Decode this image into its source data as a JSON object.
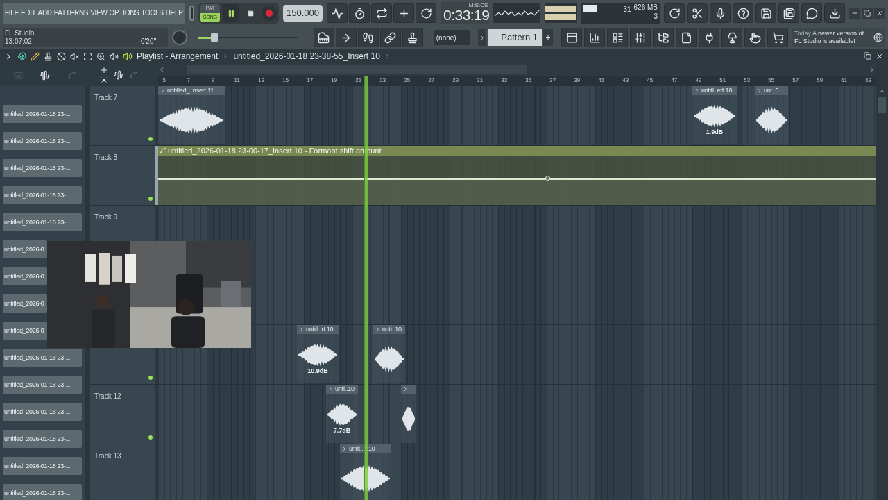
{
  "menu": [
    "FILE",
    "EDIT",
    "ADD",
    "PATTERNS",
    "VIEW",
    "OPTIONS",
    "TOOLS",
    "HELP"
  ],
  "transport": {
    "pat": "PAT",
    "song": "SONG",
    "song_selected": true,
    "playing": true,
    "tempo": "150.000"
  },
  "hint": {
    "title": "FL Studio",
    "time": "13:07:02",
    "length": "0'20''"
  },
  "master": {
    "level": 0.16
  },
  "clock": {
    "time": "0:33:19",
    "format": "M:S:CS"
  },
  "resources": {
    "cpu": "31",
    "memory": "626 MB",
    "voices": "3"
  },
  "channel_select": {
    "value": "(none)"
  },
  "pattern": {
    "name": "Pattern 1",
    "add": "+"
  },
  "news": {
    "when": "Today",
    "message": "A newer version of FL Studio is available!"
  },
  "playlist": {
    "title": "Playlist - Arrangement",
    "source": "untitled_2026-01-18 23-38-55_Insert 10",
    "picker_items": [
      "untitled_2026-01-18 23-...",
      "untitled_2026-01-18 23-...",
      "untitled_2026-01-18 23-...",
      "untitled_2026-01-18 23-...",
      "untitled_2026-01-18 23-...",
      "untitled_2026-0",
      "untitled_2026-0",
      "untitled_2026-0",
      "untitled_2026-0",
      "untitled_2026-01-18 23-...",
      "untitled_2026-01-18 23-...",
      "untitled_2026-01-18 23-...",
      "untitled_2026-01-18 23-...",
      "untitled_2026-01-18 23-...",
      "untitled_2026-01-18 23-..."
    ],
    "ruler": [
      "5",
      "7",
      "9",
      "11",
      "13",
      "15",
      "17",
      "19",
      "21",
      "23",
      "25",
      "27",
      "29",
      "31",
      "33",
      "35",
      "37",
      "39",
      "41",
      "43",
      "45",
      "47",
      "49",
      "51",
      "53",
      "55",
      "57",
      "59",
      "61",
      "63"
    ],
    "playhead": {
      "level": 0.29
    },
    "tracks": [
      {
        "kind": "audio",
        "name": "Track 7",
        "on": true,
        "clips": [
          {
            "kind": "audio",
            "label": "untitled_..nsert 11"
          },
          {
            "kind": "audio",
            "label": "untitl..ert 10",
            "gain": "1.9dB"
          },
          {
            "kind": "audio",
            "label": "unt..0"
          }
        ]
      },
      {
        "kind": "automation",
        "name": "Track 8",
        "on": true,
        "automation": {
          "label": "untitled_2026-01-18 23-00-17_Insert 10 - Formant shift amount",
          "level": 0.53
        }
      },
      {
        "kind": "audio",
        "name": "Track 9"
      },
      {
        "kind": "audio"
      },
      {
        "kind": "audio",
        "on": true,
        "clips": [
          {
            "kind": "audio",
            "label": "untitl..rt 10",
            "gain": "10.9dB"
          },
          {
            "kind": "audio",
            "label": "unti..10"
          }
        ]
      },
      {
        "kind": "audio",
        "name": "Track 12",
        "on": true,
        "clips": [
          {
            "kind": "audio",
            "label": "unti..10",
            "gain": "7.7dB"
          },
          {
            "kind": "audio"
          }
        ]
      },
      {
        "kind": "audio",
        "name": "Track 13",
        "clips": [
          {
            "kind": "audio",
            "label": "untit..rt 10"
          }
        ]
      }
    ]
  }
}
